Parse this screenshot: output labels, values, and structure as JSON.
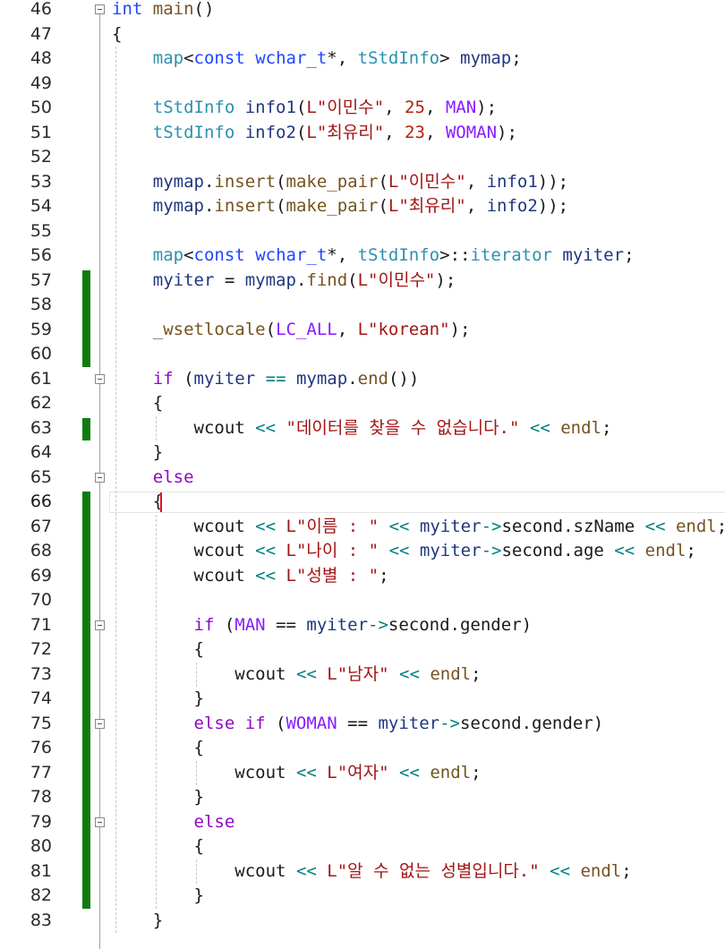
{
  "editor": {
    "language": "cpp",
    "current_line": "66",
    "lines": [
      {
        "n": "46",
        "tokens": [
          {
            "t": "int",
            "c": "kw"
          },
          {
            "t": " "
          },
          {
            "t": "main",
            "c": "func"
          },
          {
            "t": "()"
          }
        ]
      },
      {
        "n": "47",
        "tokens": [
          {
            "t": "{"
          }
        ]
      },
      {
        "n": "48",
        "tokens": [
          {
            "t": "    "
          },
          {
            "t": "map",
            "c": "type"
          },
          {
            "t": "<"
          },
          {
            "t": "const",
            "c": "kw"
          },
          {
            "t": " "
          },
          {
            "t": "wchar_t",
            "c": "kw"
          },
          {
            "t": "*, "
          },
          {
            "t": "tStdInfo",
            "c": "type"
          },
          {
            "t": "> "
          },
          {
            "t": "mymap",
            "c": "var"
          },
          {
            "t": ";"
          }
        ]
      },
      {
        "n": "49",
        "tokens": []
      },
      {
        "n": "50",
        "tokens": [
          {
            "t": "    "
          },
          {
            "t": "tStdInfo",
            "c": "type"
          },
          {
            "t": " "
          },
          {
            "t": "info1",
            "c": "var"
          },
          {
            "t": "("
          },
          {
            "t": "L\"이민수\"",
            "c": "str"
          },
          {
            "t": ", "
          },
          {
            "t": "25",
            "c": "num2"
          },
          {
            "t": ", "
          },
          {
            "t": "MAN",
            "c": "macro"
          },
          {
            "t": ");"
          }
        ]
      },
      {
        "n": "51",
        "tokens": [
          {
            "t": "    "
          },
          {
            "t": "tStdInfo",
            "c": "type"
          },
          {
            "t": " "
          },
          {
            "t": "info2",
            "c": "var"
          },
          {
            "t": "("
          },
          {
            "t": "L\"최유리\"",
            "c": "str"
          },
          {
            "t": ", "
          },
          {
            "t": "23",
            "c": "num2"
          },
          {
            "t": ", "
          },
          {
            "t": "WOMAN",
            "c": "macro"
          },
          {
            "t": ");"
          }
        ]
      },
      {
        "n": "52",
        "tokens": []
      },
      {
        "n": "53",
        "tokens": [
          {
            "t": "    "
          },
          {
            "t": "mymap",
            "c": "var"
          },
          {
            "t": "."
          },
          {
            "t": "insert",
            "c": "func"
          },
          {
            "t": "("
          },
          {
            "t": "make_pair",
            "c": "func"
          },
          {
            "t": "("
          },
          {
            "t": "L\"이민수\"",
            "c": "str"
          },
          {
            "t": ", "
          },
          {
            "t": "info1",
            "c": "var"
          },
          {
            "t": "));"
          }
        ]
      },
      {
        "n": "54",
        "tokens": [
          {
            "t": "    "
          },
          {
            "t": "mymap",
            "c": "var"
          },
          {
            "t": "."
          },
          {
            "t": "insert",
            "c": "func"
          },
          {
            "t": "("
          },
          {
            "t": "make_pair",
            "c": "func"
          },
          {
            "t": "("
          },
          {
            "t": "L\"최유리\"",
            "c": "str"
          },
          {
            "t": ", "
          },
          {
            "t": "info2",
            "c": "var"
          },
          {
            "t": "));"
          }
        ]
      },
      {
        "n": "55",
        "tokens": []
      },
      {
        "n": "56",
        "tokens": [
          {
            "t": "    "
          },
          {
            "t": "map",
            "c": "type"
          },
          {
            "t": "<"
          },
          {
            "t": "const",
            "c": "kw"
          },
          {
            "t": " "
          },
          {
            "t": "wchar_t",
            "c": "kw"
          },
          {
            "t": "*, "
          },
          {
            "t": "tStdInfo",
            "c": "type"
          },
          {
            "t": ">::"
          },
          {
            "t": "iterator",
            "c": "type"
          },
          {
            "t": " "
          },
          {
            "t": "myiter",
            "c": "var"
          },
          {
            "t": ";"
          }
        ]
      },
      {
        "n": "57",
        "tokens": [
          {
            "t": "    "
          },
          {
            "t": "myiter",
            "c": "var"
          },
          {
            "t": " = "
          },
          {
            "t": "mymap",
            "c": "var"
          },
          {
            "t": "."
          },
          {
            "t": "find",
            "c": "func"
          },
          {
            "t": "("
          },
          {
            "t": "L\"이민수\"",
            "c": "str"
          },
          {
            "t": ");"
          }
        ]
      },
      {
        "n": "58",
        "tokens": []
      },
      {
        "n": "59",
        "tokens": [
          {
            "t": "    "
          },
          {
            "t": "_wsetlocale",
            "c": "func"
          },
          {
            "t": "("
          },
          {
            "t": "LC_ALL",
            "c": "macro"
          },
          {
            "t": ", "
          },
          {
            "t": "L\"korean\"",
            "c": "str"
          },
          {
            "t": ");"
          }
        ]
      },
      {
        "n": "60",
        "tokens": []
      },
      {
        "n": "61",
        "tokens": [
          {
            "t": "    "
          },
          {
            "t": "if",
            "c": "ctrl"
          },
          {
            "t": " ("
          },
          {
            "t": "myiter",
            "c": "var"
          },
          {
            "t": " "
          },
          {
            "t": "==",
            "c": "op"
          },
          {
            "t": " "
          },
          {
            "t": "mymap",
            "c": "var"
          },
          {
            "t": "."
          },
          {
            "t": "end",
            "c": "func"
          },
          {
            "t": "())"
          }
        ]
      },
      {
        "n": "62",
        "tokens": [
          {
            "t": "    {"
          }
        ]
      },
      {
        "n": "63",
        "tokens": [
          {
            "t": "        "
          },
          {
            "t": "wcout",
            "c": "plain"
          },
          {
            "t": " "
          },
          {
            "t": "<<",
            "c": "op"
          },
          {
            "t": " "
          },
          {
            "t": "\"데이터를 찾을 수 없습니다.\"",
            "c": "str"
          },
          {
            "t": " "
          },
          {
            "t": "<<",
            "c": "op"
          },
          {
            "t": " "
          },
          {
            "t": "endl",
            "c": "func"
          },
          {
            "t": ";"
          }
        ]
      },
      {
        "n": "64",
        "tokens": [
          {
            "t": "    }"
          }
        ]
      },
      {
        "n": "65",
        "tokens": [
          {
            "t": "    "
          },
          {
            "t": "else",
            "c": "ctrl"
          }
        ]
      },
      {
        "n": "66",
        "tokens": [
          {
            "t": "    {"
          }
        ]
      },
      {
        "n": "67",
        "tokens": [
          {
            "t": "        "
          },
          {
            "t": "wcout",
            "c": "plain"
          },
          {
            "t": " "
          },
          {
            "t": "<<",
            "c": "op"
          },
          {
            "t": " "
          },
          {
            "t": "L\"이름 : \"",
            "c": "str"
          },
          {
            "t": " "
          },
          {
            "t": "<<",
            "c": "op"
          },
          {
            "t": " "
          },
          {
            "t": "myiter",
            "c": "var"
          },
          {
            "t": "->",
            "c": "op"
          },
          {
            "t": "second.szName"
          },
          {
            "t": " "
          },
          {
            "t": "<<",
            "c": "op"
          },
          {
            "t": " "
          },
          {
            "t": "endl",
            "c": "func"
          },
          {
            "t": ";"
          }
        ]
      },
      {
        "n": "68",
        "tokens": [
          {
            "t": "        "
          },
          {
            "t": "wcout",
            "c": "plain"
          },
          {
            "t": " "
          },
          {
            "t": "<<",
            "c": "op"
          },
          {
            "t": " "
          },
          {
            "t": "L\"나이 : \"",
            "c": "str"
          },
          {
            "t": " "
          },
          {
            "t": "<<",
            "c": "op"
          },
          {
            "t": " "
          },
          {
            "t": "myiter",
            "c": "var"
          },
          {
            "t": "->",
            "c": "op"
          },
          {
            "t": "second.age"
          },
          {
            "t": " "
          },
          {
            "t": "<<",
            "c": "op"
          },
          {
            "t": " "
          },
          {
            "t": "endl",
            "c": "func"
          },
          {
            "t": ";"
          }
        ]
      },
      {
        "n": "69",
        "tokens": [
          {
            "t": "        "
          },
          {
            "t": "wcout",
            "c": "plain"
          },
          {
            "t": " "
          },
          {
            "t": "<<",
            "c": "op"
          },
          {
            "t": " "
          },
          {
            "t": "L\"성별 : \"",
            "c": "str"
          },
          {
            "t": ";"
          }
        ]
      },
      {
        "n": "70",
        "tokens": []
      },
      {
        "n": "71",
        "tokens": [
          {
            "t": "        "
          },
          {
            "t": "if",
            "c": "ctrl"
          },
          {
            "t": " ("
          },
          {
            "t": "MAN",
            "c": "macro"
          },
          {
            "t": " == "
          },
          {
            "t": "myiter",
            "c": "var"
          },
          {
            "t": "->",
            "c": "op"
          },
          {
            "t": "second.gender)"
          }
        ]
      },
      {
        "n": "72",
        "tokens": [
          {
            "t": "        {"
          }
        ]
      },
      {
        "n": "73",
        "tokens": [
          {
            "t": "            "
          },
          {
            "t": "wcout",
            "c": "plain"
          },
          {
            "t": " "
          },
          {
            "t": "<<",
            "c": "op"
          },
          {
            "t": " "
          },
          {
            "t": "L\"남자\"",
            "c": "str"
          },
          {
            "t": " "
          },
          {
            "t": "<<",
            "c": "op"
          },
          {
            "t": " "
          },
          {
            "t": "endl",
            "c": "func"
          },
          {
            "t": ";"
          }
        ]
      },
      {
        "n": "74",
        "tokens": [
          {
            "t": "        }"
          }
        ]
      },
      {
        "n": "75",
        "tokens": [
          {
            "t": "        "
          },
          {
            "t": "else if",
            "c": "ctrl"
          },
          {
            "t": " ("
          },
          {
            "t": "WOMAN",
            "c": "macro"
          },
          {
            "t": " == "
          },
          {
            "t": "myiter",
            "c": "var"
          },
          {
            "t": "->",
            "c": "op"
          },
          {
            "t": "second.gender)"
          }
        ]
      },
      {
        "n": "76",
        "tokens": [
          {
            "t": "        {"
          }
        ]
      },
      {
        "n": "77",
        "tokens": [
          {
            "t": "            "
          },
          {
            "t": "wcout",
            "c": "plain"
          },
          {
            "t": " "
          },
          {
            "t": "<<",
            "c": "op"
          },
          {
            "t": " "
          },
          {
            "t": "L\"여자\"",
            "c": "str"
          },
          {
            "t": " "
          },
          {
            "t": "<<",
            "c": "op"
          },
          {
            "t": " "
          },
          {
            "t": "endl",
            "c": "func"
          },
          {
            "t": ";"
          }
        ]
      },
      {
        "n": "78",
        "tokens": [
          {
            "t": "        }"
          }
        ]
      },
      {
        "n": "79",
        "tokens": [
          {
            "t": "        "
          },
          {
            "t": "else",
            "c": "ctrl"
          }
        ]
      },
      {
        "n": "80",
        "tokens": [
          {
            "t": "        {"
          }
        ]
      },
      {
        "n": "81",
        "tokens": [
          {
            "t": "            "
          },
          {
            "t": "wcout",
            "c": "plain"
          },
          {
            "t": " "
          },
          {
            "t": "<<",
            "c": "op"
          },
          {
            "t": " "
          },
          {
            "t": "L\"알 수 없는 성별입니다.\"",
            "c": "str"
          },
          {
            "t": " "
          },
          {
            "t": "<<",
            "c": "op"
          },
          {
            "t": " "
          },
          {
            "t": "endl",
            "c": "func"
          },
          {
            "t": ";"
          }
        ]
      },
      {
        "n": "82",
        "tokens": [
          {
            "t": "        }"
          }
        ]
      },
      {
        "n": "83",
        "tokens": [
          {
            "t": "    }"
          }
        ]
      }
    ],
    "changed_lines": [
      "57",
      "58",
      "59",
      "60",
      "63",
      "66",
      "67",
      "68",
      "69",
      "70",
      "71",
      "72",
      "73",
      "74",
      "75",
      "76",
      "77",
      "78",
      "79",
      "80",
      "81",
      "82"
    ],
    "fold_markers": [
      "46",
      "61",
      "65",
      "71",
      "75",
      "79"
    ],
    "colors": {
      "keyword": "#1f46ff",
      "type": "#2b91af",
      "control": "#8f08c4",
      "function": "#74531f",
      "string": "#a31515",
      "number": "#b5200d",
      "macro": "#8a1bff",
      "variable": "#1f377f",
      "operator": "#008080",
      "change_bar": "#107c10",
      "caret": "#e81123"
    }
  }
}
